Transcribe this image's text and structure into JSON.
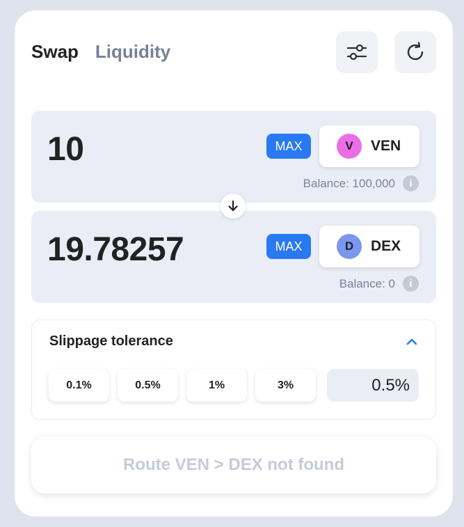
{
  "tabs": {
    "swap": "Swap",
    "liquidity": "Liquidity"
  },
  "icons": {
    "settings": "sliders-icon",
    "refresh": "refresh-icon",
    "swap_direction": "arrow-down-icon",
    "info": "info-icon",
    "collapse": "chevron-up-icon"
  },
  "from": {
    "amount": "10",
    "max_label": "MAX",
    "token_badge": "V",
    "token_symbol": "VEN",
    "token_color": "#ea6ee6",
    "balance": "Balance: 100,000",
    "info_glyph": "i"
  },
  "to": {
    "amount": "19.78257",
    "max_label": "MAX",
    "token_badge": "D",
    "token_symbol": "DEX",
    "token_color": "#7a96ef",
    "balance": "Balance: 0",
    "info_glyph": "i"
  },
  "slippage": {
    "title": "Slippage tolerance",
    "options": [
      "0.1%",
      "0.5%",
      "1%",
      "3%"
    ],
    "custom_value": "0.5%"
  },
  "route_button": {
    "label": "Route VEN > DEX not found"
  },
  "colors": {
    "accent": "#2879f2",
    "panel_bg": "#eaedf5",
    "page_bg": "#dfe3ee",
    "disabled_text": "#c5cbd8"
  }
}
